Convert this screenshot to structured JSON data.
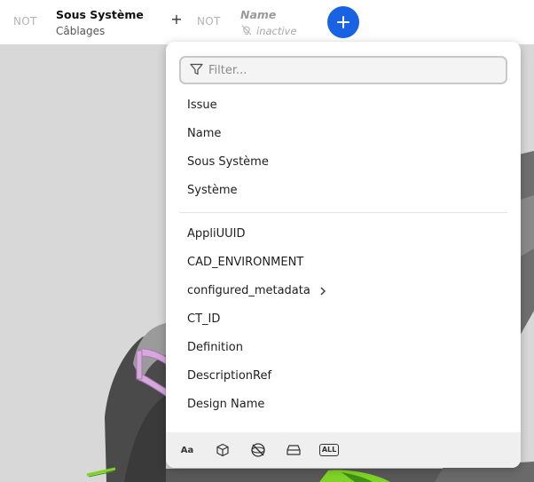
{
  "filters": {
    "first": {
      "not_label": "NOT",
      "title": "Sous Système",
      "value": "Câblages"
    },
    "add_symbol": "+",
    "second": {
      "not_label": "NOT",
      "title": "Name",
      "status": "inactive"
    }
  },
  "dropdown": {
    "filter_placeholder": "Filter...",
    "filter_value": "",
    "primary_items": [
      {
        "label": "Issue"
      },
      {
        "label": "Name"
      },
      {
        "label": "Sous Système"
      },
      {
        "label": "Système"
      }
    ],
    "attribute_items": [
      {
        "label": "AppliUUID"
      },
      {
        "label": "CAD_ENVIRONMENT"
      },
      {
        "label": "configured_metadata",
        "has_submenu": true
      },
      {
        "label": "CT_ID"
      },
      {
        "label": "Definition"
      },
      {
        "label": "DescriptionRef"
      },
      {
        "label": "Design Name"
      }
    ],
    "footer_icons": [
      "text-type-icon",
      "cube-icon",
      "no-sphere-icon",
      "box-stack-icon",
      "all-icon"
    ],
    "footer_text_icon_label": "Aa",
    "footer_all_label": "ALL"
  },
  "colors": {
    "accent": "#1863e3",
    "viewport_bg": "#d8d8d8",
    "wire_green": "#7fd326"
  }
}
